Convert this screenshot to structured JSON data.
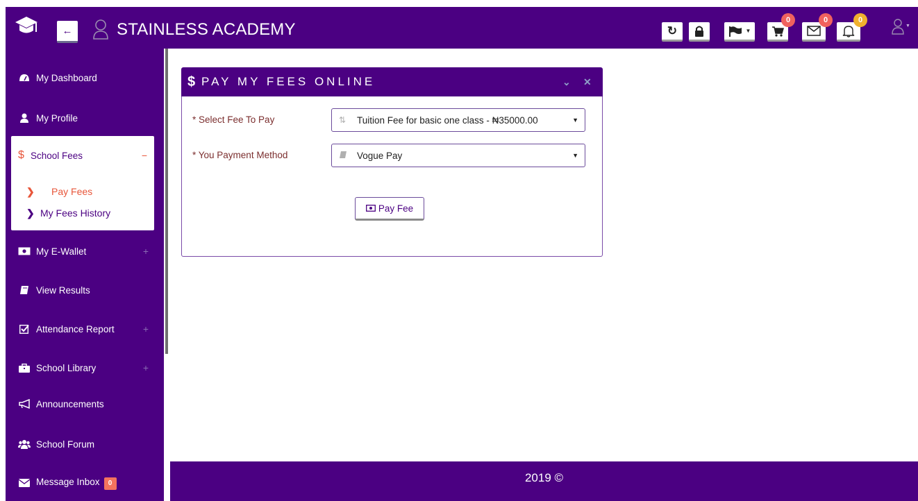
{
  "header": {
    "title": "STAINLESS ACADEMY",
    "icons": [
      "graduation-cap-icon",
      "arrow-left-icon",
      "user-avatar-icon",
      "refresh-icon",
      "lock-icon",
      "flag-icon",
      "cart-icon",
      "envelope-icon",
      "bell-icon"
    ],
    "badges": {
      "cart": "0",
      "messages": "0",
      "notifications": "0"
    },
    "colors": {
      "bar": "#4b0082",
      "badge_red": "#f0625e",
      "badge_yellow": "#f0b12e"
    }
  },
  "sidebar": {
    "items": [
      {
        "label": "My Dashboard",
        "icon": "dashboard-icon"
      },
      {
        "label": "My Profile",
        "icon": "user-icon"
      },
      {
        "label": "School Fees",
        "icon": "dollar-icon",
        "expanded": true,
        "children": [
          {
            "label": "Pay Fees",
            "active": true
          },
          {
            "label": "My Fees History"
          }
        ]
      },
      {
        "label": "My E-Wallet",
        "icon": "wallet-icon",
        "expandable": true
      },
      {
        "label": "View Results",
        "icon": "book-icon"
      },
      {
        "label": "Attendance Report",
        "icon": "checkbox-icon",
        "expandable": true
      },
      {
        "label": "School Library",
        "icon": "briefcase-icon",
        "expandable": true
      },
      {
        "label": "Announcements",
        "icon": "megaphone-icon"
      },
      {
        "label": "School Forum",
        "icon": "users-icon"
      },
      {
        "label": "Message Inbox",
        "icon": "envelope-icon",
        "badge": "0"
      }
    ],
    "plus_symbol": "+",
    "minus_symbol": "−"
  },
  "panel": {
    "title": "PAY MY FEES ONLINE",
    "icon": "dollar-icon",
    "fields": {
      "fee": {
        "label": "* Select Fee To Pay",
        "value": "Tuition Fee for basic one class - ₦35000.00",
        "icon": "sort-alpha-icon"
      },
      "method": {
        "label": "* You Payment Method",
        "value": "Vogue Pay",
        "icon": "book-icon"
      }
    },
    "submit_label": "Pay Fee",
    "submit_icon": "money-icon"
  },
  "footer": {
    "text": "2019 ©"
  }
}
